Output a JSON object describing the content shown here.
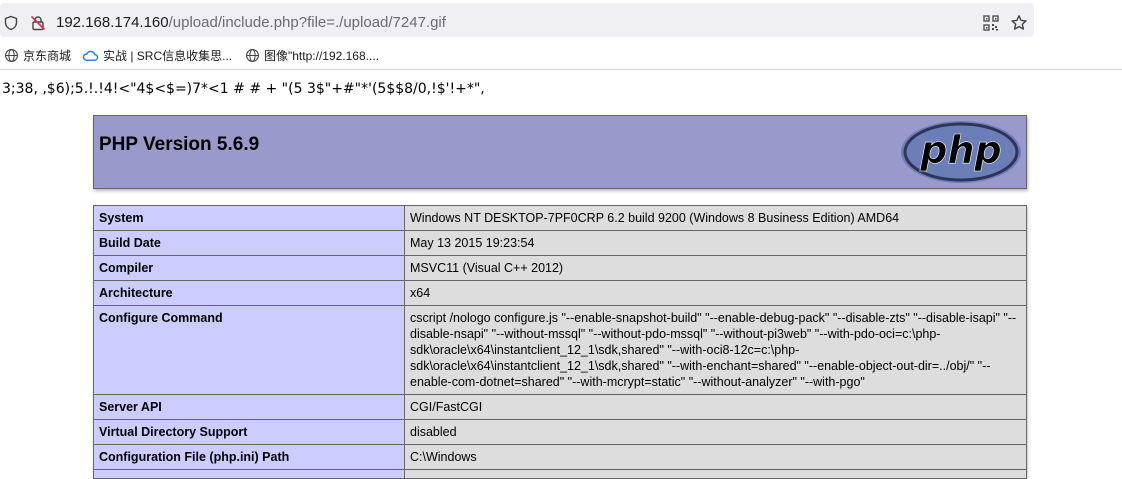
{
  "browser": {
    "url_host": "192.168.174.160",
    "url_path": "/upload/include.php?file=./upload/7247.gif",
    "icons": [
      "shield-icon",
      "insecure-lock-icon",
      "qr-code-icon",
      "star-icon"
    ],
    "bookmarks": [
      {
        "label": "京东商城",
        "icon": "globe-icon"
      },
      {
        "label": "实战 | SRC信息收集思...",
        "icon": "cloud-icon"
      },
      {
        "label": "图像\"http://192.168....",
        "icon": "globe-icon"
      }
    ]
  },
  "page": {
    "garbage_text": "3;38, ,$6);5.!.!4!<\"4$<$=)7*<1 # # + \"(5 3$\"+#\"*'(5$$8/0,!$'!+*\",",
    "php_version_title": "PHP Version 5.6.9",
    "logo_text": "php",
    "colors": {
      "header_bg": "#9999cc",
      "key_bg": "#ccccff",
      "value_bg": "#dddddd"
    },
    "rows": [
      {
        "key": "System",
        "value": "Windows NT DESKTOP-7PF0CRP 6.2 build 9200 (Windows 8 Business Edition) AMD64"
      },
      {
        "key": "Build Date",
        "value": "May 13 2015 19:23:54"
      },
      {
        "key": "Compiler",
        "value": "MSVC11 (Visual C++ 2012)"
      },
      {
        "key": "Architecture",
        "value": "x64"
      },
      {
        "key": "Configure Command",
        "value": "cscript /nologo configure.js \"--enable-snapshot-build\" \"--enable-debug-pack\" \"--disable-zts\" \"--disable-isapi\" \"--disable-nsapi\" \"--without-mssql\" \"--without-pdo-mssql\" \"--without-pi3web\" \"--with-pdo-oci=c:\\php-sdk\\oracle\\x64\\instantclient_12_1\\sdk,shared\" \"--with-oci8-12c=c:\\php-sdk\\oracle\\x64\\instantclient_12_1\\sdk,shared\" \"--with-enchant=shared\" \"--enable-object-out-dir=../obj/\" \"--enable-com-dotnet=shared\" \"--with-mcrypt=static\" \"--without-analyzer\" \"--with-pgo\""
      },
      {
        "key": "Server API",
        "value": "CGI/FastCGI"
      },
      {
        "key": "Virtual Directory Support",
        "value": "disabled"
      },
      {
        "key": "Configuration File (php.ini) Path",
        "value": "C:\\Windows"
      },
      {
        "key": "",
        "value": ""
      }
    ]
  }
}
